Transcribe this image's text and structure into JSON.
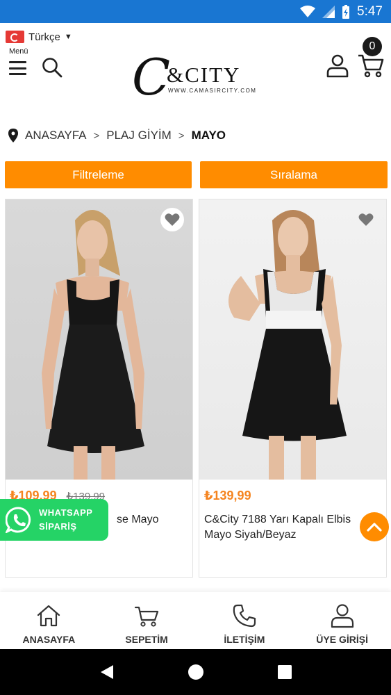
{
  "status_bar": {
    "time": "5:47"
  },
  "header": {
    "language": "Türkçe",
    "menu_label": "Menü",
    "cart_count": "0",
    "logo": {
      "mark": "C",
      "brand": "&CITY",
      "url": "WWW.CAMASIRCITY.COM"
    }
  },
  "breadcrumb": {
    "items": [
      "ANASAYFA",
      "PLAJ GİYİM",
      "MAYO"
    ],
    "separator": ">"
  },
  "toolbar": {
    "filter_label": "Filtreleme",
    "sort_label": "Sıralama"
  },
  "products": [
    {
      "price": "₺109,99",
      "old_price": "₺139,99",
      "name": "se Mayo"
    },
    {
      "price": "₺139,99",
      "old_price": "",
      "name": "C&City 7188 Yarı Kapalı Elbis Mayo Siyah/Beyaz"
    }
  ],
  "whatsapp": {
    "line1": "WHATSAPP",
    "line2": "SİPARİŞ"
  },
  "bottom_nav": [
    {
      "label": "ANASAYFA",
      "icon": "home-icon"
    },
    {
      "label": "SEPETİM",
      "icon": "cart-icon"
    },
    {
      "label": "İLETİŞİM",
      "icon": "phone-icon"
    },
    {
      "label": "ÜYE GİRİŞİ",
      "icon": "user-icon"
    }
  ],
  "colors": {
    "accent": "#ff8c00",
    "price": "#f5841f",
    "status_bar": "#1976d2",
    "whatsapp": "#25d366"
  }
}
